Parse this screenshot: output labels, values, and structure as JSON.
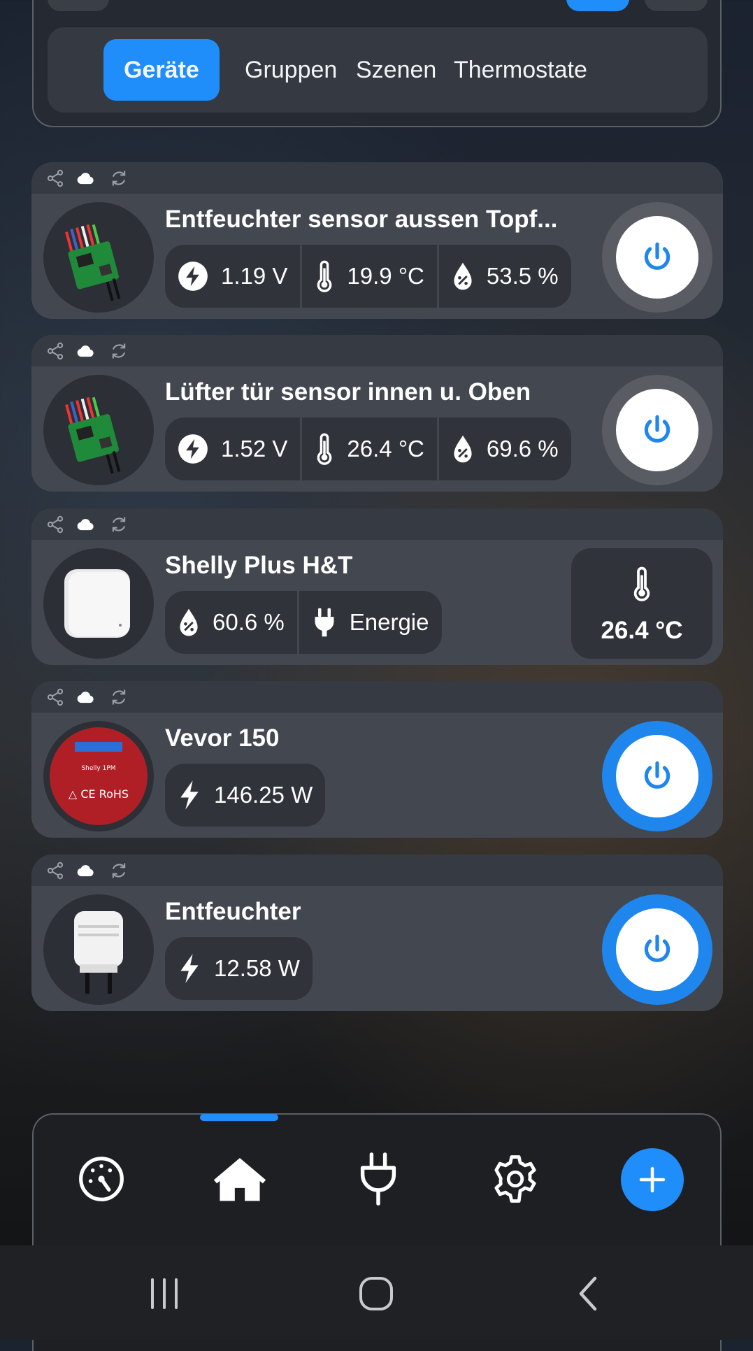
{
  "tabs": [
    "Geräte",
    "Gruppen",
    "Szenen",
    "Thermostate"
  ],
  "active_tab": "Geräte",
  "devices": [
    {
      "name": "Entfeuchter sensor aussen Topf...",
      "voltage": "1.19 V",
      "temperature": "19.9 °C",
      "humidity": "53.5 %",
      "power_on": false,
      "thumbnail": "pcb-sensor-icon"
    },
    {
      "name": "Lüfter tür sensor innen u. Oben",
      "voltage": "1.52 V",
      "temperature": "26.4 °C",
      "humidity": "69.6 %",
      "power_on": false,
      "thumbnail": "pcb-sensor-icon"
    },
    {
      "name": "Shelly Plus H&T",
      "humidity": "60.6 %",
      "energy_label": "Energie",
      "temperature": "26.4 °C",
      "thumbnail": "ht-sensor-icon"
    },
    {
      "name": "Vevor 150",
      "power": "146.25 W",
      "power_on": true,
      "thumbnail": "relay-module-icon"
    },
    {
      "name": "Entfeuchter",
      "power": "12.58 W",
      "power_on": true,
      "thumbnail": "smart-plug-icon"
    }
  ],
  "header_icons": [
    "share-icon",
    "cloud-icon",
    "refresh-icon"
  ],
  "nav": [
    "dashboard-icon",
    "home-icon",
    "plug-icon",
    "settings-icon",
    "add-icon"
  ],
  "active_nav": "home-icon",
  "system_nav": [
    "recent-apps-icon",
    "home-circle-icon",
    "back-icon"
  ],
  "colors": {
    "accent": "#1f8efa",
    "card": "#434750",
    "chip": "#30333a"
  }
}
